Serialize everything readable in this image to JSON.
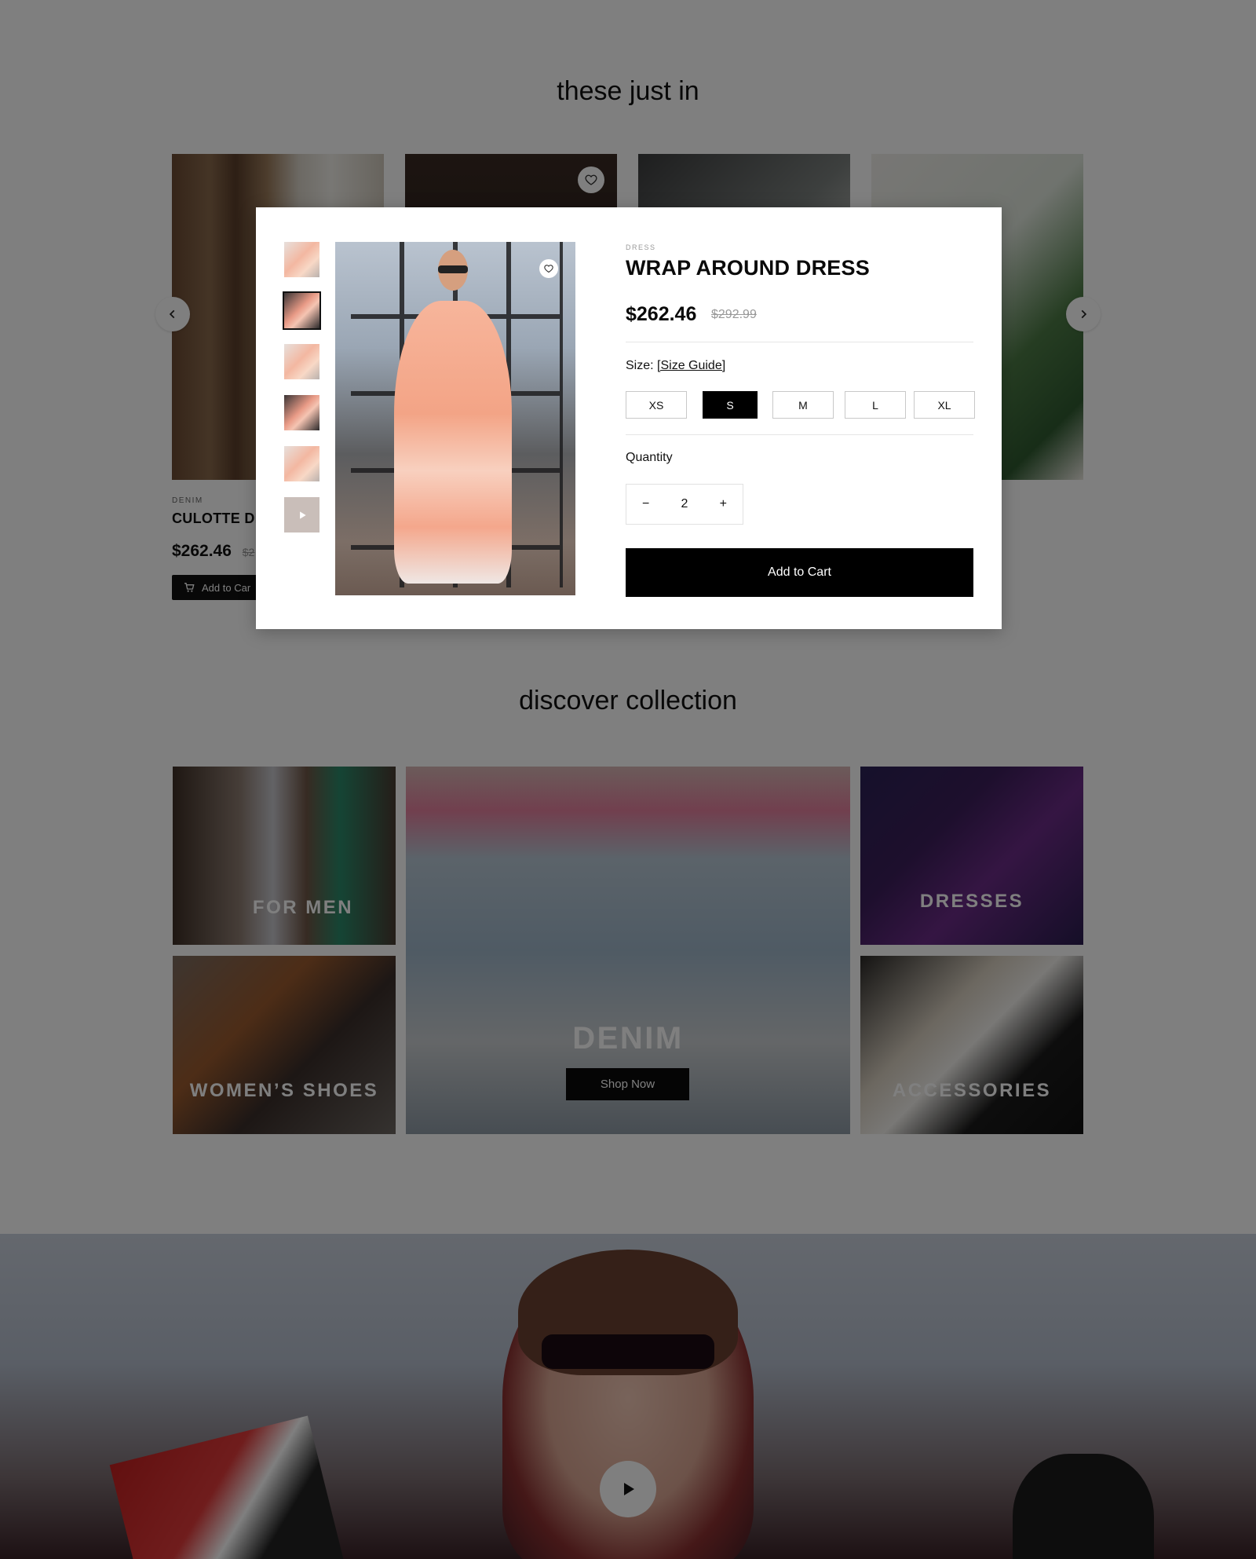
{
  "sections": {
    "new_in_title": "these just in",
    "collection_title": "discover collection"
  },
  "background_card": {
    "category": "DENIM",
    "name": "CULOTTE DI",
    "price": "$262.46",
    "old_price": "$2",
    "cart_label": "Add to Car"
  },
  "collection": {
    "men": "FOR MEN",
    "denim": "DENIM",
    "dresses": "DRESSES",
    "shoes": "WOMEN’S SHOES",
    "accessories": "ACCESSORIES",
    "shop_now": "Shop Now"
  },
  "modal": {
    "category": "DRESS",
    "title": "WRAP AROUND DRESS",
    "price": "$262.46",
    "old_price": "$292.99",
    "size_label": "Size: ",
    "size_guide": "[Size Guide]",
    "sizes": [
      "XS",
      "S",
      "M",
      "L",
      "XL"
    ],
    "selected_size": "S",
    "quantity_label": "Quantity",
    "quantity": "2",
    "minus": "−",
    "plus": "+",
    "add_to_cart": "Add to Cart"
  },
  "icons": {
    "wishlist": "heart-icon",
    "arrow_prev": "chevron-left-icon",
    "arrow_next": "chevron-right-icon",
    "cart": "cart-icon",
    "play": "play-icon"
  },
  "colors": {
    "overlay": "rgba(0,0,0,0.5)",
    "primary": "#000000",
    "muted": "#999999"
  }
}
